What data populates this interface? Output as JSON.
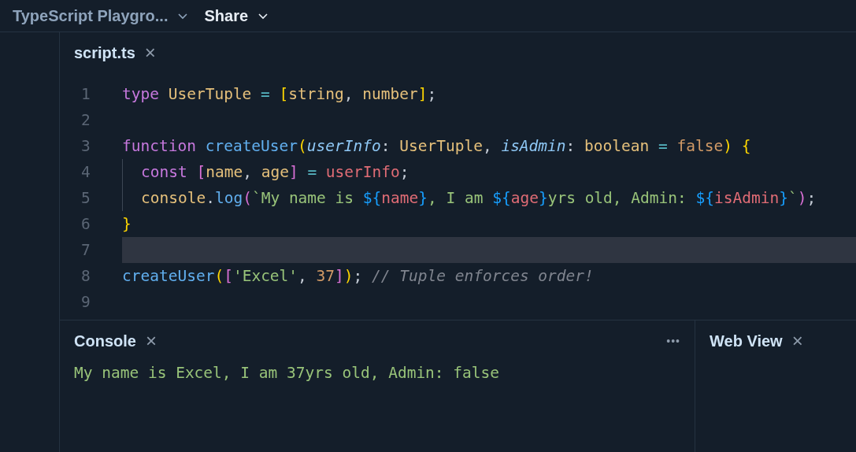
{
  "top_bar": {
    "items": [
      {
        "label": "TypeScript Playgro...",
        "selected": false
      },
      {
        "label": "Share",
        "selected": true
      }
    ]
  },
  "editor": {
    "tab": {
      "label": "script.ts",
      "close": "×"
    },
    "lines": [
      {
        "number": "1",
        "current": false,
        "indent": false,
        "tokens": [
          {
            "kind": "keyword",
            "text": "type "
          },
          {
            "kind": "type",
            "text": "UserTuple "
          },
          {
            "kind": "operator",
            "text": "= "
          },
          {
            "kind": "bracket1",
            "text": "["
          },
          {
            "kind": "type",
            "text": "string"
          },
          {
            "kind": "plain",
            "text": ", "
          },
          {
            "kind": "type",
            "text": "number"
          },
          {
            "kind": "bracket1",
            "text": "]"
          },
          {
            "kind": "plain",
            "text": ";"
          }
        ]
      },
      {
        "number": "2",
        "current": false,
        "indent": false
      },
      {
        "number": "3",
        "current": false,
        "indent": false,
        "tokens": [
          {
            "kind": "keyword",
            "text": "function "
          },
          {
            "kind": "function",
            "text": "createUser"
          },
          {
            "kind": "bracket1",
            "text": "("
          },
          {
            "kind": "param",
            "text": "userInfo"
          },
          {
            "kind": "plain",
            "text": ": "
          },
          {
            "kind": "type",
            "text": "UserTuple"
          },
          {
            "kind": "plain",
            "text": ", "
          },
          {
            "kind": "param",
            "text": "isAdmin"
          },
          {
            "kind": "plain",
            "text": ": "
          },
          {
            "kind": "type",
            "text": "boolean "
          },
          {
            "kind": "operator",
            "text": "= "
          },
          {
            "kind": "number",
            "text": "false"
          },
          {
            "kind": "bracket1",
            "text": ") {"
          }
        ]
      },
      {
        "number": "4",
        "current": false,
        "indent": true,
        "tokens": [
          {
            "kind": "keyword",
            "text": "const "
          },
          {
            "kind": "bracket2",
            "text": "["
          },
          {
            "kind": "type",
            "text": "name"
          },
          {
            "kind": "plain",
            "text": ", "
          },
          {
            "kind": "type",
            "text": "age"
          },
          {
            "kind": "bracket2",
            "text": "] "
          },
          {
            "kind": "operator",
            "text": "= "
          },
          {
            "kind": "variable",
            "text": "userInfo"
          },
          {
            "kind": "plain",
            "text": ";"
          }
        ]
      },
      {
        "number": "5",
        "current": false,
        "indent": true,
        "tokens": [
          {
            "kind": "type",
            "text": "console"
          },
          {
            "kind": "plain",
            "text": "."
          },
          {
            "kind": "function",
            "text": "log"
          },
          {
            "kind": "bracket2",
            "text": "("
          },
          {
            "kind": "string",
            "text": "`My name is "
          },
          {
            "kind": "bracket3",
            "text": "${"
          },
          {
            "kind": "variable",
            "text": "name"
          },
          {
            "kind": "bracket3",
            "text": "}"
          },
          {
            "kind": "string",
            "text": ", I am "
          },
          {
            "kind": "bracket3",
            "text": "${"
          },
          {
            "kind": "variable",
            "text": "age"
          },
          {
            "kind": "bracket3",
            "text": "}"
          },
          {
            "kind": "string",
            "text": "yrs old, Admin: "
          },
          {
            "kind": "bracket3",
            "text": "${"
          },
          {
            "kind": "variable",
            "text": "isAdmin"
          },
          {
            "kind": "bracket3",
            "text": "}"
          },
          {
            "kind": "string",
            "text": "`"
          },
          {
            "kind": "bracket2",
            "text": ")"
          },
          {
            "kind": "plain",
            "text": ";"
          }
        ]
      },
      {
        "number": "6",
        "current": false,
        "indent": false,
        "tokens": [
          {
            "kind": "bracket1",
            "text": "}"
          }
        ]
      },
      {
        "number": "7",
        "current": true,
        "indent": false
      },
      {
        "number": "8",
        "current": false,
        "indent": false,
        "tokens": [
          {
            "kind": "function",
            "text": "createUser"
          },
          {
            "kind": "bracket1",
            "text": "("
          },
          {
            "kind": "bracket2",
            "text": "["
          },
          {
            "kind": "string",
            "text": "'Excel'"
          },
          {
            "kind": "plain",
            "text": ", "
          },
          {
            "kind": "number",
            "text": "37"
          },
          {
            "kind": "bracket2",
            "text": "]"
          },
          {
            "kind": "bracket1",
            "text": ")"
          },
          {
            "kind": "plain",
            "text": "; "
          },
          {
            "kind": "comment",
            "text": "// Tuple enforces order!"
          }
        ]
      },
      {
        "number": "9",
        "current": false,
        "indent": false
      }
    ]
  },
  "console": {
    "title": "Console",
    "close": "×",
    "menu": "•••",
    "output": "My name is Excel, I am 37yrs old, Admin: false"
  },
  "web_view": {
    "title": "Web View",
    "close": "×"
  }
}
